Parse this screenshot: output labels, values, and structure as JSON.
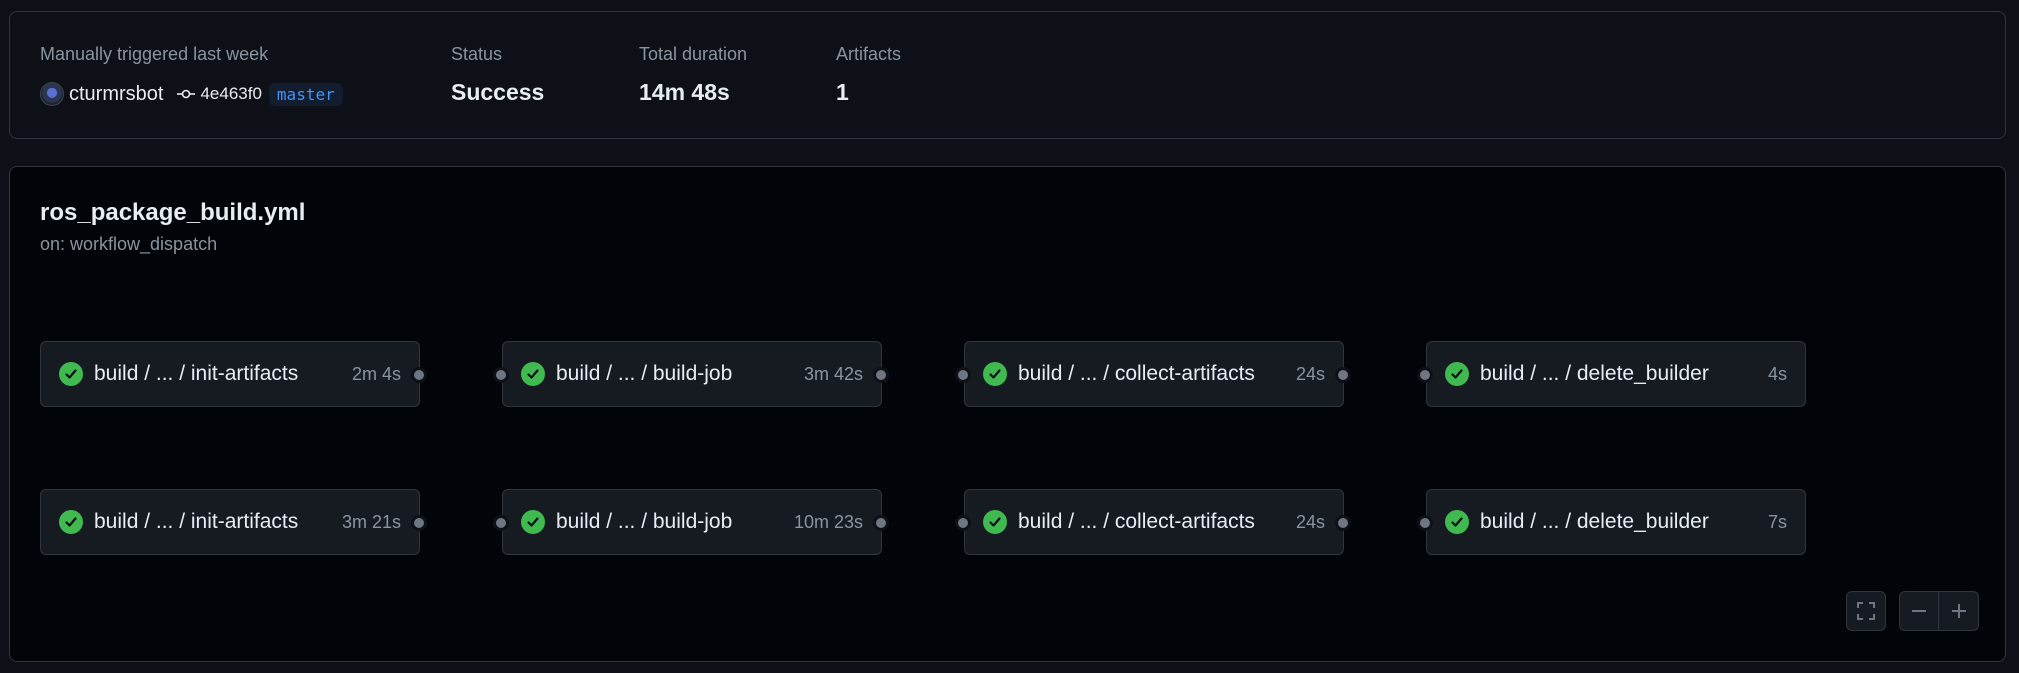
{
  "summary": {
    "trigger_label": "Manually triggered last week",
    "user": "cturmrsbot",
    "commit": "4e463f0",
    "branch": "master",
    "status_label": "Status",
    "status_value": "Success",
    "duration_label": "Total duration",
    "duration_value": "14m 48s",
    "artifacts_label": "Artifacts",
    "artifacts_value": "1"
  },
  "workflow": {
    "file": "ros_package_build.yml",
    "trigger": "on: workflow_dispatch"
  },
  "rows": [
    {
      "jobs": [
        {
          "name": "build / ... / init-artifacts",
          "duration": "2m 4s",
          "status": "success"
        },
        {
          "name": "build / ... / build-job",
          "duration": "3m 42s",
          "status": "success"
        },
        {
          "name": "build / ... / collect-artifacts",
          "duration": "24s",
          "status": "success"
        },
        {
          "name": "build / ... / delete_builder",
          "duration": "4s",
          "status": "success"
        }
      ]
    },
    {
      "jobs": [
        {
          "name": "build / ... / init-artifacts",
          "duration": "3m 21s",
          "status": "success"
        },
        {
          "name": "build / ... / build-job",
          "duration": "10m 23s",
          "status": "success"
        },
        {
          "name": "build / ... / collect-artifacts",
          "duration": "24s",
          "status": "success"
        },
        {
          "name": "build / ... / delete_builder",
          "duration": "7s",
          "status": "success"
        }
      ]
    }
  ],
  "controls": {
    "fullscreen_icon": "fullscreen-icon",
    "zoom_out_icon": "minus-icon",
    "zoom_in_icon": "plus-icon"
  },
  "colors": {
    "success": "#3fb950",
    "accent": "#4493f8"
  }
}
